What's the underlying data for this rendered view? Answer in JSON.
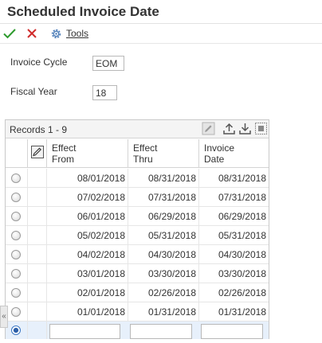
{
  "page": {
    "title": "Scheduled Invoice Date"
  },
  "toolbar": {
    "tools_label": "Tools"
  },
  "form": {
    "invoice_cycle_label": "Invoice Cycle",
    "invoice_cycle_value": "EOM",
    "fiscal_year_label": "Fiscal Year",
    "fiscal_year_value": "18"
  },
  "grid": {
    "records_label": "Records 1 - 9",
    "columns": [
      {
        "line1": "Effect",
        "line2": "From"
      },
      {
        "line1": "Effect",
        "line2": "Thru"
      },
      {
        "line1": "Invoice",
        "line2": "Date"
      }
    ],
    "rows": [
      {
        "effect_from": "08/01/2018",
        "effect_thru": "08/31/2018",
        "invoice_date": "08/31/2018"
      },
      {
        "effect_from": "07/02/2018",
        "effect_thru": "07/31/2018",
        "invoice_date": "07/31/2018"
      },
      {
        "effect_from": "06/01/2018",
        "effect_thru": "06/29/2018",
        "invoice_date": "06/29/2018"
      },
      {
        "effect_from": "05/02/2018",
        "effect_thru": "05/31/2018",
        "invoice_date": "05/31/2018"
      },
      {
        "effect_from": "04/02/2018",
        "effect_thru": "04/30/2018",
        "invoice_date": "04/30/2018"
      },
      {
        "effect_from": "03/01/2018",
        "effect_thru": "03/30/2018",
        "invoice_date": "03/30/2018"
      },
      {
        "effect_from": "02/01/2018",
        "effect_thru": "02/26/2018",
        "invoice_date": "02/26/2018"
      },
      {
        "effect_from": "01/01/2018",
        "effect_thru": "01/31/2018",
        "invoice_date": "01/31/2018"
      }
    ]
  },
  "sidebar": {
    "collapse_label": "«"
  },
  "icons": {
    "ok": "checkmark-icon",
    "cancel": "close-icon",
    "tools": "gear-icon",
    "edit": "pencil-icon",
    "upload": "upload-icon",
    "download": "download-icon",
    "grid_view": "grid-view-icon",
    "row_select": "edit-row-icon"
  },
  "colors": {
    "ok": "#2e9b2e",
    "cancel": "#d02b2b",
    "accent": "#2c5fa8"
  }
}
